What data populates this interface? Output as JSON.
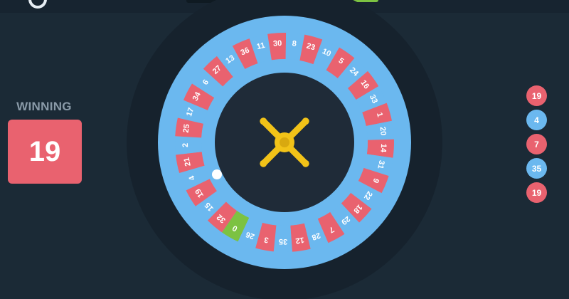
{
  "winning": {
    "label": "WINNING",
    "number": "19"
  },
  "history": [
    {
      "number": "19",
      "color": "red"
    },
    {
      "number": "4",
      "color": "blue"
    },
    {
      "number": "7",
      "color": "red"
    },
    {
      "number": "35",
      "color": "blue"
    },
    {
      "number": "19",
      "color": "red"
    }
  ],
  "wheel": {
    "numbers": [
      "0",
      "32",
      "15",
      "19",
      "4",
      "21",
      "2",
      "25",
      "17",
      "34",
      "6",
      "27",
      "13",
      "36",
      "11",
      "30",
      "8",
      "23",
      "10",
      "5",
      "24",
      "16",
      "33",
      "1",
      "20",
      "14",
      "31",
      "9",
      "22",
      "18",
      "29",
      "7",
      "28",
      "12",
      "35",
      "3",
      "26"
    ],
    "colors": {
      "red": "#e9626f",
      "blue": "#6bb8ef",
      "green": "#7cc242",
      "outer_ring": "#6bb8ef",
      "hub": "#1f2b38",
      "spinner": "#f2c318",
      "ball": "#ffffff"
    }
  }
}
